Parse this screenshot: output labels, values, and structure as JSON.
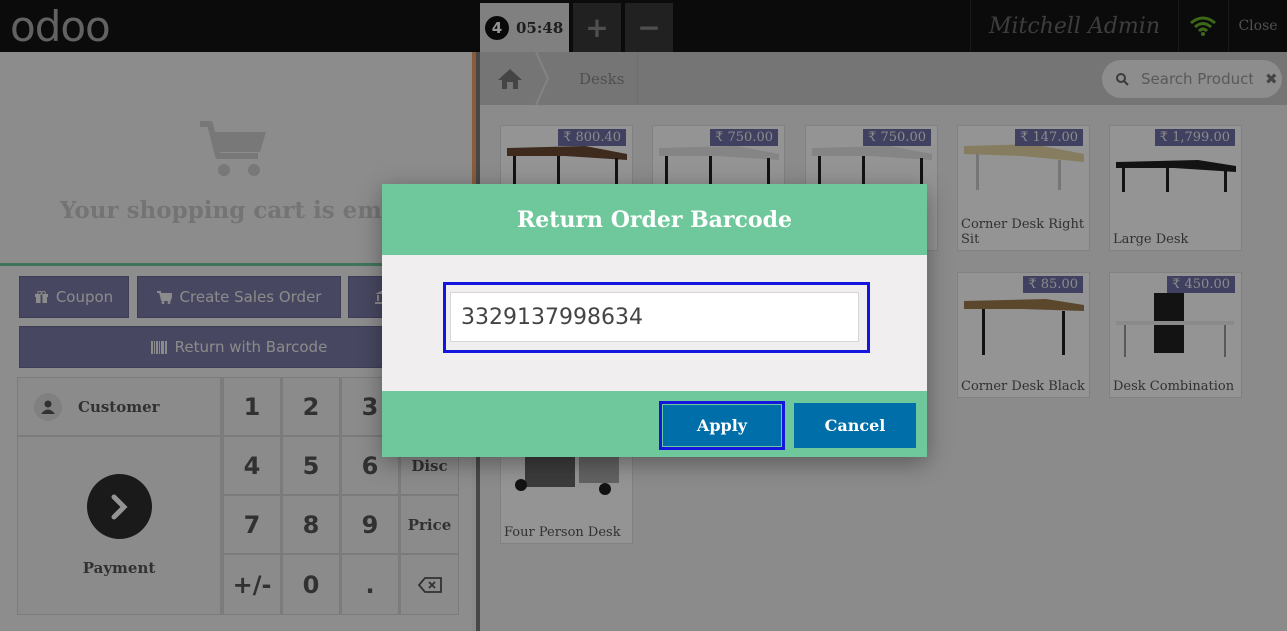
{
  "topbar": {
    "logo": "odoo",
    "order_number": "4",
    "order_time": "05:48",
    "add_label": "+",
    "remove_label": "−",
    "user": "Mitchell Admin",
    "close_label": "Close"
  },
  "cart": {
    "empty_text": "Your shopping cart is empty"
  },
  "actions": {
    "coupon": "Coupon",
    "create_sales_order": "Create Sales Order",
    "return_with_barcode": "Return with Barcode"
  },
  "numpad": {
    "customer": "Customer",
    "payment": "Payment",
    "keys": [
      "1",
      "2",
      "3",
      "4",
      "5",
      "6",
      "7",
      "8",
      "9",
      "+/-",
      "0",
      "."
    ],
    "modes": {
      "disc": "Disc",
      "price": "Price"
    }
  },
  "breadcrumb": {
    "category": "Desks"
  },
  "search": {
    "placeholder": "Search Products"
  },
  "products": [
    {
      "name": "",
      "price": "₹ 800.40"
    },
    {
      "name": "",
      "price": "₹ 750.00"
    },
    {
      "name": "",
      "price": "₹ 750.00"
    },
    {
      "name": "Corner Desk Right Sit",
      "price": "₹ 147.00"
    },
    {
      "name": "Large Desk",
      "price": "₹ 1,799.00"
    },
    {
      "name": "Corner Desk Black",
      "price": "₹ 85.00"
    },
    {
      "name": "Desk Combination",
      "price": "₹ 450.00"
    },
    {
      "name": "Four Person Desk",
      "price": ""
    }
  ],
  "dialog": {
    "title": "Return Order Barcode",
    "barcode_value": "3329137998634",
    "apply": "Apply",
    "cancel": "Cancel"
  },
  "colors": {
    "topbar": "#141414",
    "accent_green": "#6ec89b",
    "button_blue": "#006ea8",
    "control_purple": "#7b7ba8",
    "focus_blue": "#1515e0"
  }
}
